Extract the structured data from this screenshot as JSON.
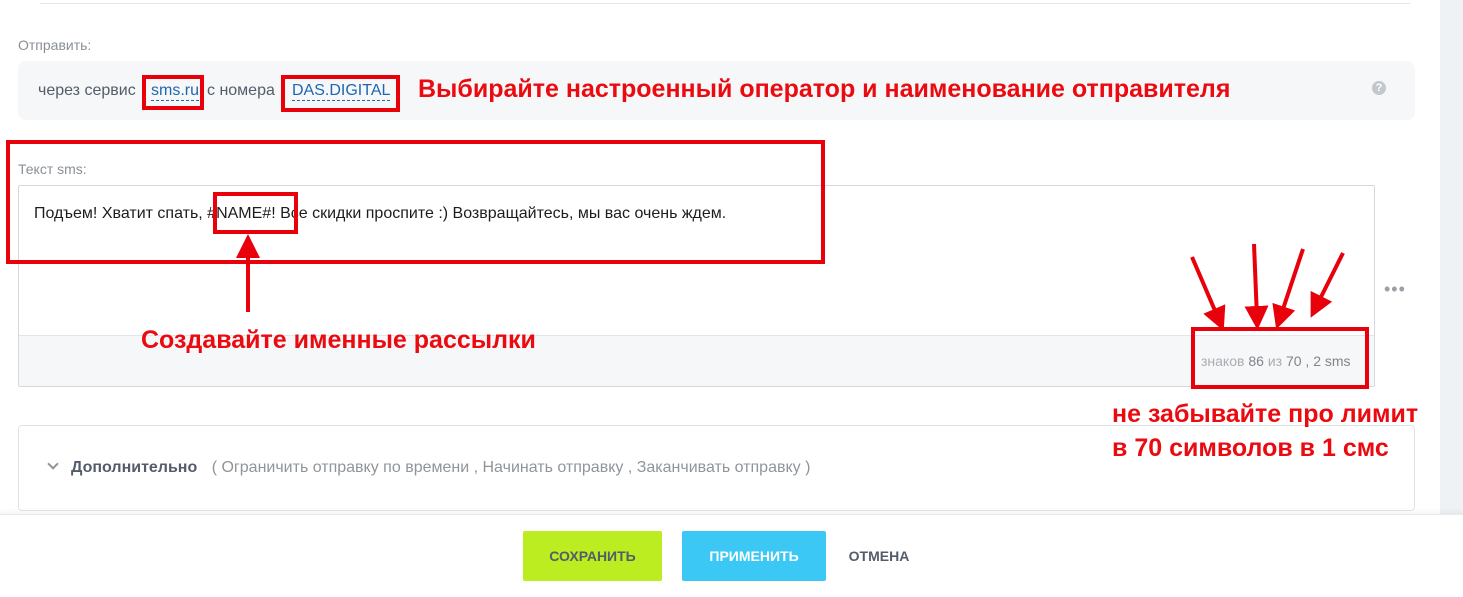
{
  "send_section": {
    "label": "Отправить:",
    "prefix": "через сервис",
    "service": "sms.ru",
    "middle": "с номера",
    "sender": "DAS.DIGITAL",
    "help_icon": "?"
  },
  "sms_section": {
    "label": "Текст sms:",
    "text_before": "Подъем! Хватит спать, ",
    "placeholder_token": "#NAME#",
    "text_after": "! Все скидки проспите :) Возвращайтесь, мы вас очень ждем.",
    "counter": {
      "prefix": "знаков",
      "count": "86",
      "of": "из",
      "limit": "70",
      "sms_count": ", 2 sms"
    },
    "more": "•••"
  },
  "extra_section": {
    "title": "Дополнительно",
    "open": "(",
    "options": [
      "Ограничить отправку по времени",
      "Начинать отправку",
      "Заканчивать отправку"
    ],
    "close": ")"
  },
  "footer": {
    "save": "СОХРАНИТЬ",
    "apply": "ПРИМЕНИТЬ",
    "cancel": "ОТМЕНА"
  },
  "annotations": {
    "operator": "Выбирайте настроенный оператор и наименование отправителя",
    "named": "Создавайте именные рассылки",
    "limit_line1": "не забывайте про лимит",
    "limit_line2": "в 70 символов в 1 смс",
    "color": "#e8000b"
  }
}
